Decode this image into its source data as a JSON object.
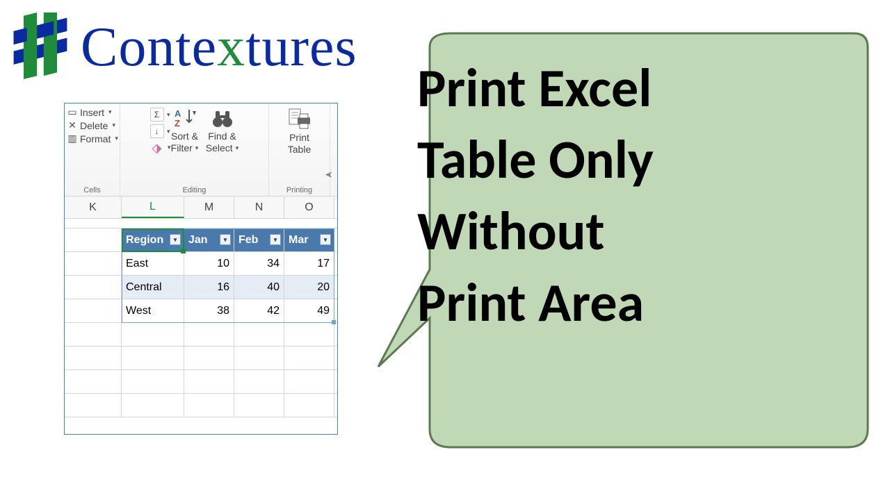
{
  "brand": {
    "pre": "Conte",
    "x": "x",
    "post": "tures"
  },
  "ribbon": {
    "cells": {
      "label": "Cells",
      "insert": "Insert",
      "delete": "Delete",
      "format": "Format"
    },
    "editing": {
      "label": "Editing",
      "sortFilter_l1": "Sort &",
      "sortFilter_l2": "Filter",
      "findSelect_l1": "Find &",
      "findSelect_l2": "Select",
      "sum_icon": "Σ",
      "fill_icon": "↓",
      "clear_icon": "◧"
    },
    "printing": {
      "label": "Printing",
      "print_l1": "Print",
      "print_l2": "Table"
    }
  },
  "columns": {
    "k": "K",
    "l": "L",
    "m": "M",
    "n": "N",
    "o": "O"
  },
  "table": {
    "headers": {
      "region": "Region",
      "jan": "Jan",
      "feb": "Feb",
      "mar": "Mar"
    },
    "rows": [
      {
        "region": "East",
        "jan": "10",
        "feb": "34",
        "mar": "17"
      },
      {
        "region": "Central",
        "jan": "16",
        "feb": "40",
        "mar": "20"
      },
      {
        "region": "West",
        "jan": "38",
        "feb": "42",
        "mar": "49"
      }
    ]
  },
  "callout": {
    "l1": "Print Excel",
    "l2": "Table Only",
    "l3": "Without",
    "l4": "Print Area"
  },
  "colors": {
    "brandBlue": "#0a2aa0",
    "brandGreen": "#1e8c3a",
    "bubble": "#c1d8b7",
    "tableHeader": "#4a7aab"
  }
}
